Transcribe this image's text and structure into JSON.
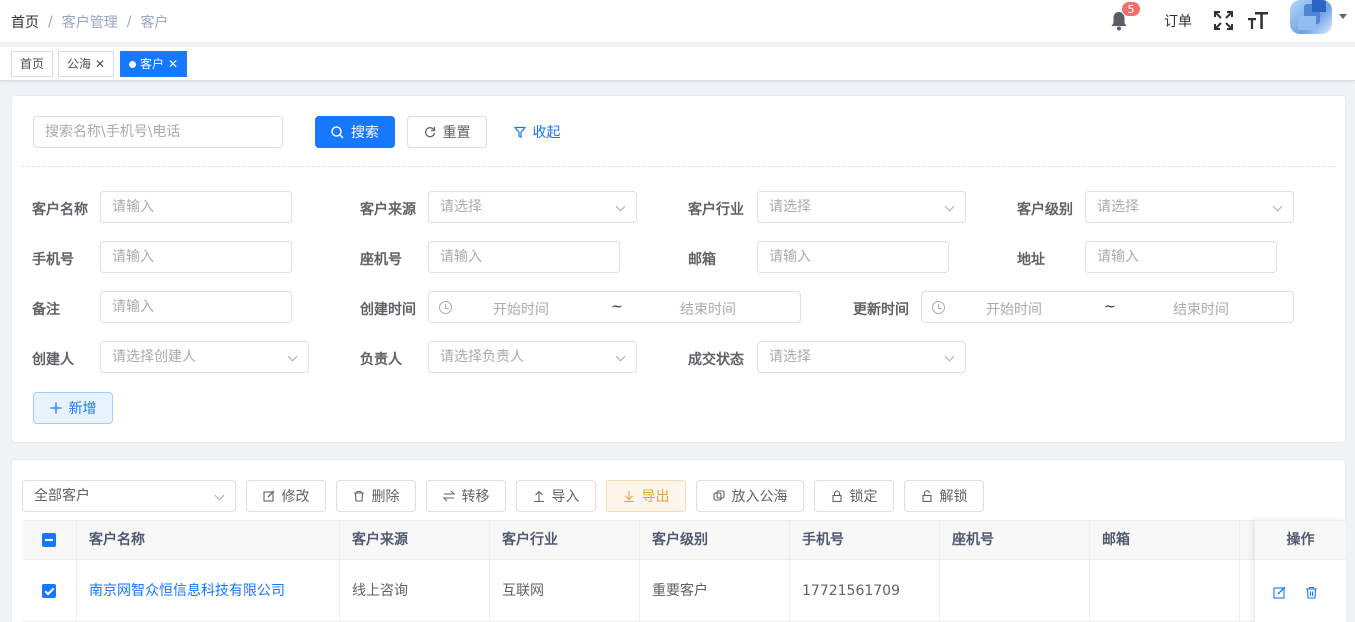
{
  "header": {
    "breadcrumbs": [
      "首页",
      "客户管理",
      "客户"
    ],
    "separator": "/",
    "notification_count": "5",
    "order_label": "订单"
  },
  "tags": [
    {
      "label": "首页",
      "active": false
    },
    {
      "label": "公海",
      "active": false,
      "closable": true
    },
    {
      "label": "客户",
      "active": true,
      "closable": true
    }
  ],
  "search": {
    "keyword_placeholder": "搜索名称\\手机号\\电话",
    "search_label": "搜索",
    "reset_label": "重置",
    "collapse_label": "收起"
  },
  "filters": {
    "customer_name": {
      "label": "客户名称",
      "placeholder": "请输入"
    },
    "customer_source": {
      "label": "客户来源",
      "placeholder": "请选择"
    },
    "customer_industry": {
      "label": "客户行业",
      "placeholder": "请选择"
    },
    "customer_level": {
      "label": "客户级别",
      "placeholder": "请选择"
    },
    "mobile": {
      "label": "手机号",
      "placeholder": "请输入"
    },
    "landline": {
      "label": "座机号",
      "placeholder": "请输入"
    },
    "email": {
      "label": "邮箱",
      "placeholder": "请输入"
    },
    "address": {
      "label": "地址",
      "placeholder": "请输入"
    },
    "remark": {
      "label": "备注",
      "placeholder": "请输入"
    },
    "created_time": {
      "label": "创建时间",
      "start": "开始时间",
      "sep": "~",
      "end": "结束时间"
    },
    "updated_time": {
      "label": "更新时间",
      "start": "开始时间",
      "sep": "~",
      "end": "结束时间"
    },
    "creator": {
      "label": "创建人",
      "placeholder": "请选择创建人"
    },
    "owner": {
      "label": "负责人",
      "placeholder": "请选择负责人"
    },
    "deal_status": {
      "label": "成交状态",
      "placeholder": "请选择"
    },
    "add_label": "新增"
  },
  "toolbar": {
    "scope_value": "全部客户",
    "edit": "修改",
    "delete": "删除",
    "transfer": "转移",
    "import": "导入",
    "export": "导出",
    "to_pool": "放入公海",
    "lock": "锁定",
    "unlock": "解锁"
  },
  "table": {
    "columns": [
      "客户名称",
      "客户来源",
      "客户行业",
      "客户级别",
      "手机号",
      "座机号",
      "邮箱"
    ],
    "action_column": "操作",
    "rows": [
      {
        "checked": true,
        "cells": [
          "南京网智众恒信息科技有限公司",
          "线上咨询",
          "互联网",
          "重要客户",
          "17721561709",
          "",
          ""
        ]
      }
    ]
  },
  "colors": {
    "primary": "#1677ff",
    "badge": "#f56c6c",
    "warning": "#e6a23c"
  }
}
